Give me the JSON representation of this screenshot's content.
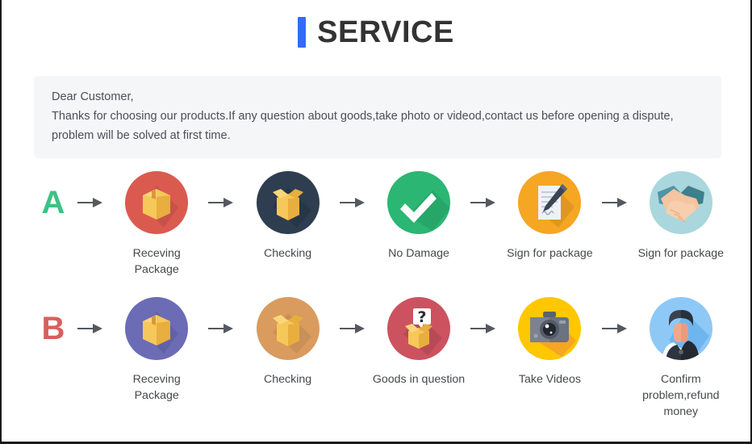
{
  "header": {
    "title": "SERVICE",
    "accent_color": "#2f6df6"
  },
  "notice": {
    "background": "#f5f6f8",
    "lines": [
      "Dear Customer,",
      "Thanks for choosing our products.If any question about goods,take photo or videod,contact us before opening a dispute,",
      "problem will be solved at first time."
    ]
  },
  "flows": [
    {
      "letter": "A",
      "letter_color": "#3ec186",
      "steps": [
        {
          "label": "Receving Package",
          "icon": "closed-box-icon",
          "circle_color": "#db5a50"
        },
        {
          "label": "Checking",
          "icon": "open-box-icon",
          "circle_color": "#2e3e50"
        },
        {
          "label": "No Damage",
          "icon": "check-mark-icon",
          "circle_color": "#2bb673"
        },
        {
          "label": "Sign for package",
          "icon": "document-pen-icon",
          "circle_color": "#f5a623"
        },
        {
          "label": "Sign for package",
          "icon": "handshake-icon",
          "circle_color": "#a9d7dd"
        }
      ]
    },
    {
      "letter": "B",
      "letter_color": "#d9605c",
      "steps": [
        {
          "label": "Receving Package",
          "icon": "closed-box-icon",
          "circle_color": "#6b6cb5"
        },
        {
          "label": "Checking",
          "icon": "open-box-icon",
          "circle_color": "#d99b5e"
        },
        {
          "label": "Goods in question",
          "icon": "question-box-icon",
          "circle_color": "#cc5260"
        },
        {
          "label": "Take Videos",
          "icon": "camera-icon",
          "circle_color": "#ffc700"
        },
        {
          "label": "Confirm problem,refund money",
          "icon": "person-icon",
          "circle_color": "#8ec8f6"
        }
      ]
    }
  ]
}
